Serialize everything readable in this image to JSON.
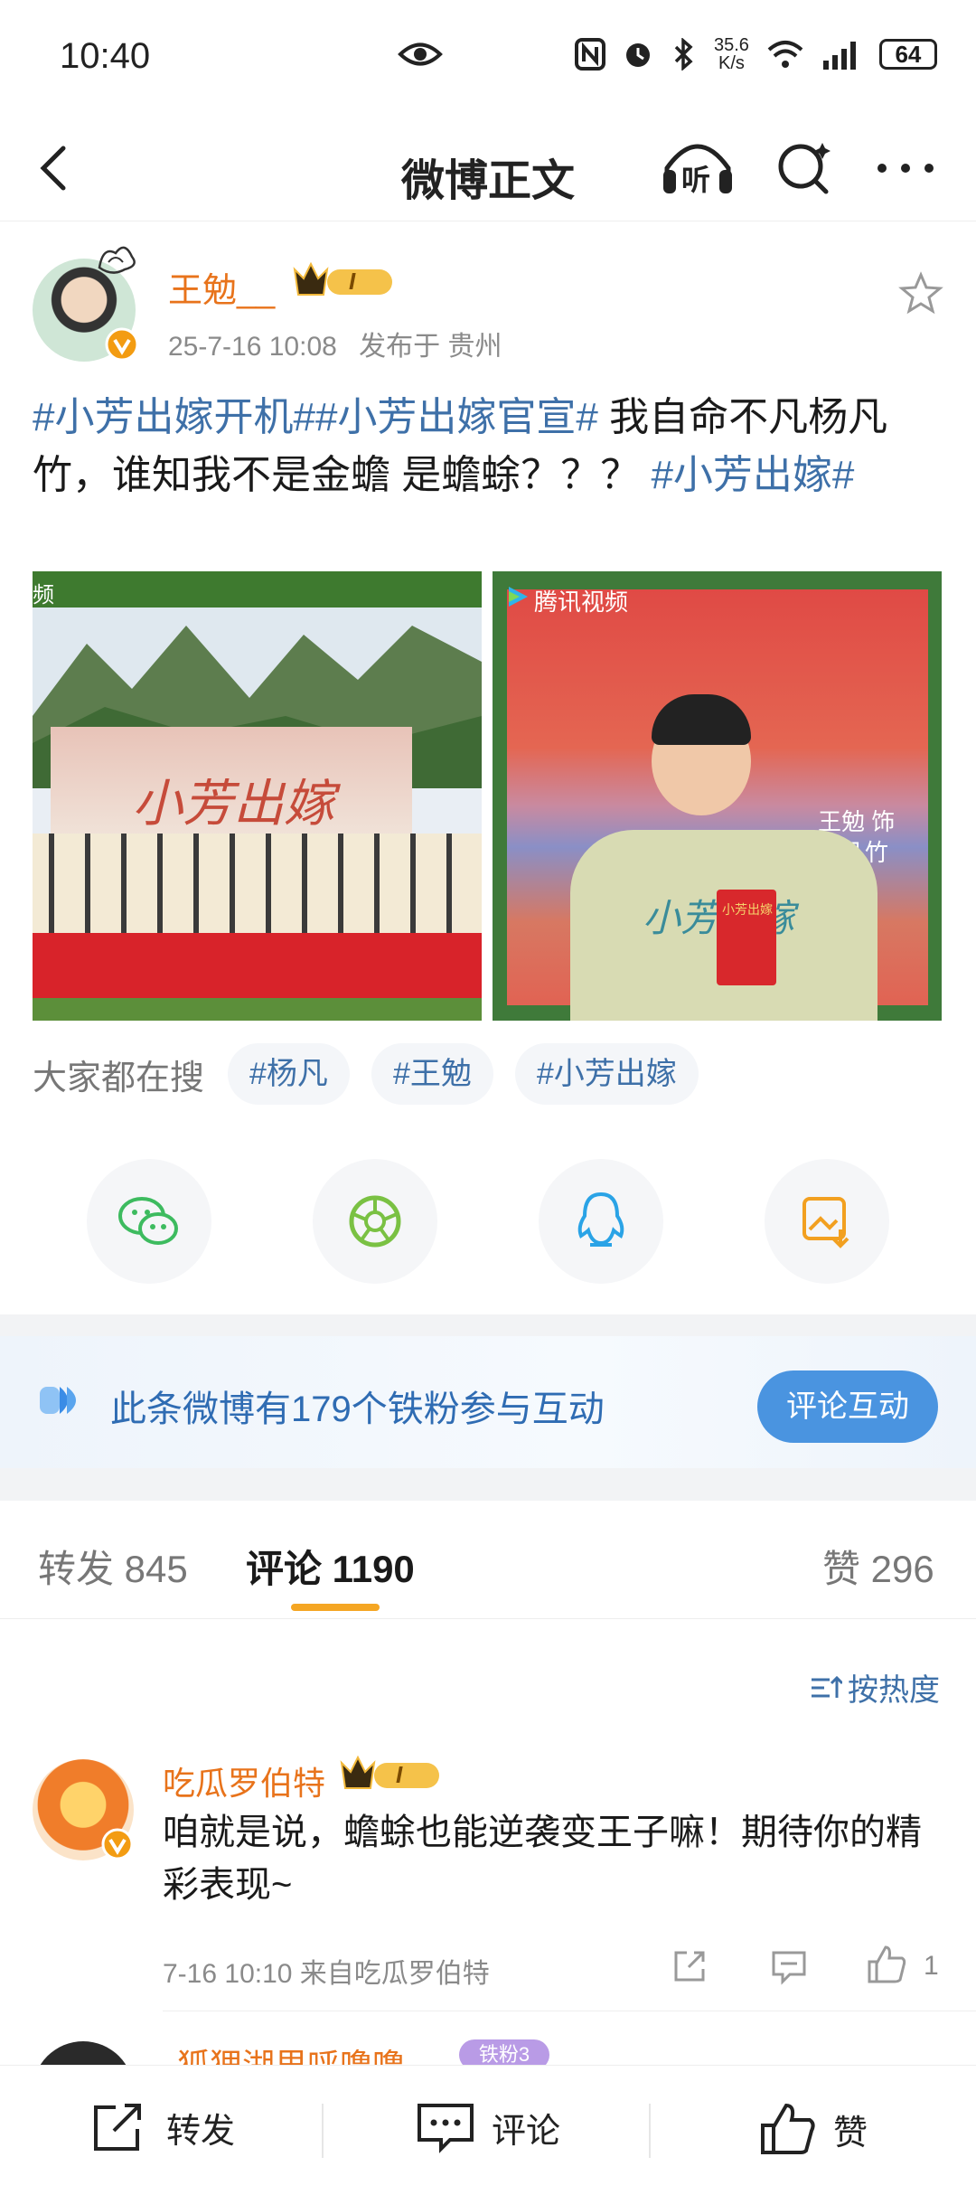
{
  "status_bar": {
    "time": "10:40",
    "net_speed_value": "35.6",
    "net_speed_unit": "K/s",
    "battery": "64"
  },
  "nav": {
    "title": "微博正文",
    "listen_label": "听"
  },
  "post": {
    "author": "王勉__",
    "level_badge": "I",
    "timestamp": "25-7-16 10:08",
    "location": "发布于 贵州",
    "text_parts": {
      "topic1": "#小芳出嫁开机#",
      "topic2": "#小芳出嫁官宣#",
      "body": " 我自命不凡杨凡竹，谁知我不是金蟾 是蟾蜍？？？ ",
      "topic3": "#小芳出嫁#"
    },
    "images": [
      {
        "banner_text": "小芳出嫁",
        "corner_text": "频"
      },
      {
        "watermark": "腾讯视频",
        "shirt_text": "小芳出嫁",
        "side_text": "王勉 饰 杨凡竹",
        "card_text": "小芳出嫁"
      }
    ],
    "search_label": "大家都在搜",
    "search_tags": [
      "#杨凡",
      "#王勉",
      "#小芳出嫁"
    ]
  },
  "share": {
    "icons": [
      "wechat-icon",
      "moments-icon",
      "qq-icon",
      "save-image-icon"
    ]
  },
  "fans_banner": {
    "text": "此条微博有179个铁粉参与互动",
    "button": "评论互动"
  },
  "tabs": {
    "repost": "转发 845",
    "comment": "评论 1190",
    "like": "赞 296"
  },
  "comments": {
    "sort_label": "按热度",
    "items": [
      {
        "name": "吃瓜罗伯特",
        "badge": "I",
        "text": "咱就是说，蟾蜍也能逆袭变王子嘛！期待你的精彩表现~",
        "meta": "7-16 10:10 来自吃瓜罗伯特",
        "likes": "1"
      },
      {
        "name": "狐狸湖里呼噜噜",
        "badge": "铁粉3"
      }
    ]
  },
  "bottom_bar": {
    "repost": "转发",
    "comment": "评论",
    "like": "赞"
  },
  "colors": {
    "accent_orange": "#e8731b",
    "link_blue": "#3e70a8",
    "button_blue": "#4a94e0",
    "tab_indicator": "#f5a623"
  }
}
